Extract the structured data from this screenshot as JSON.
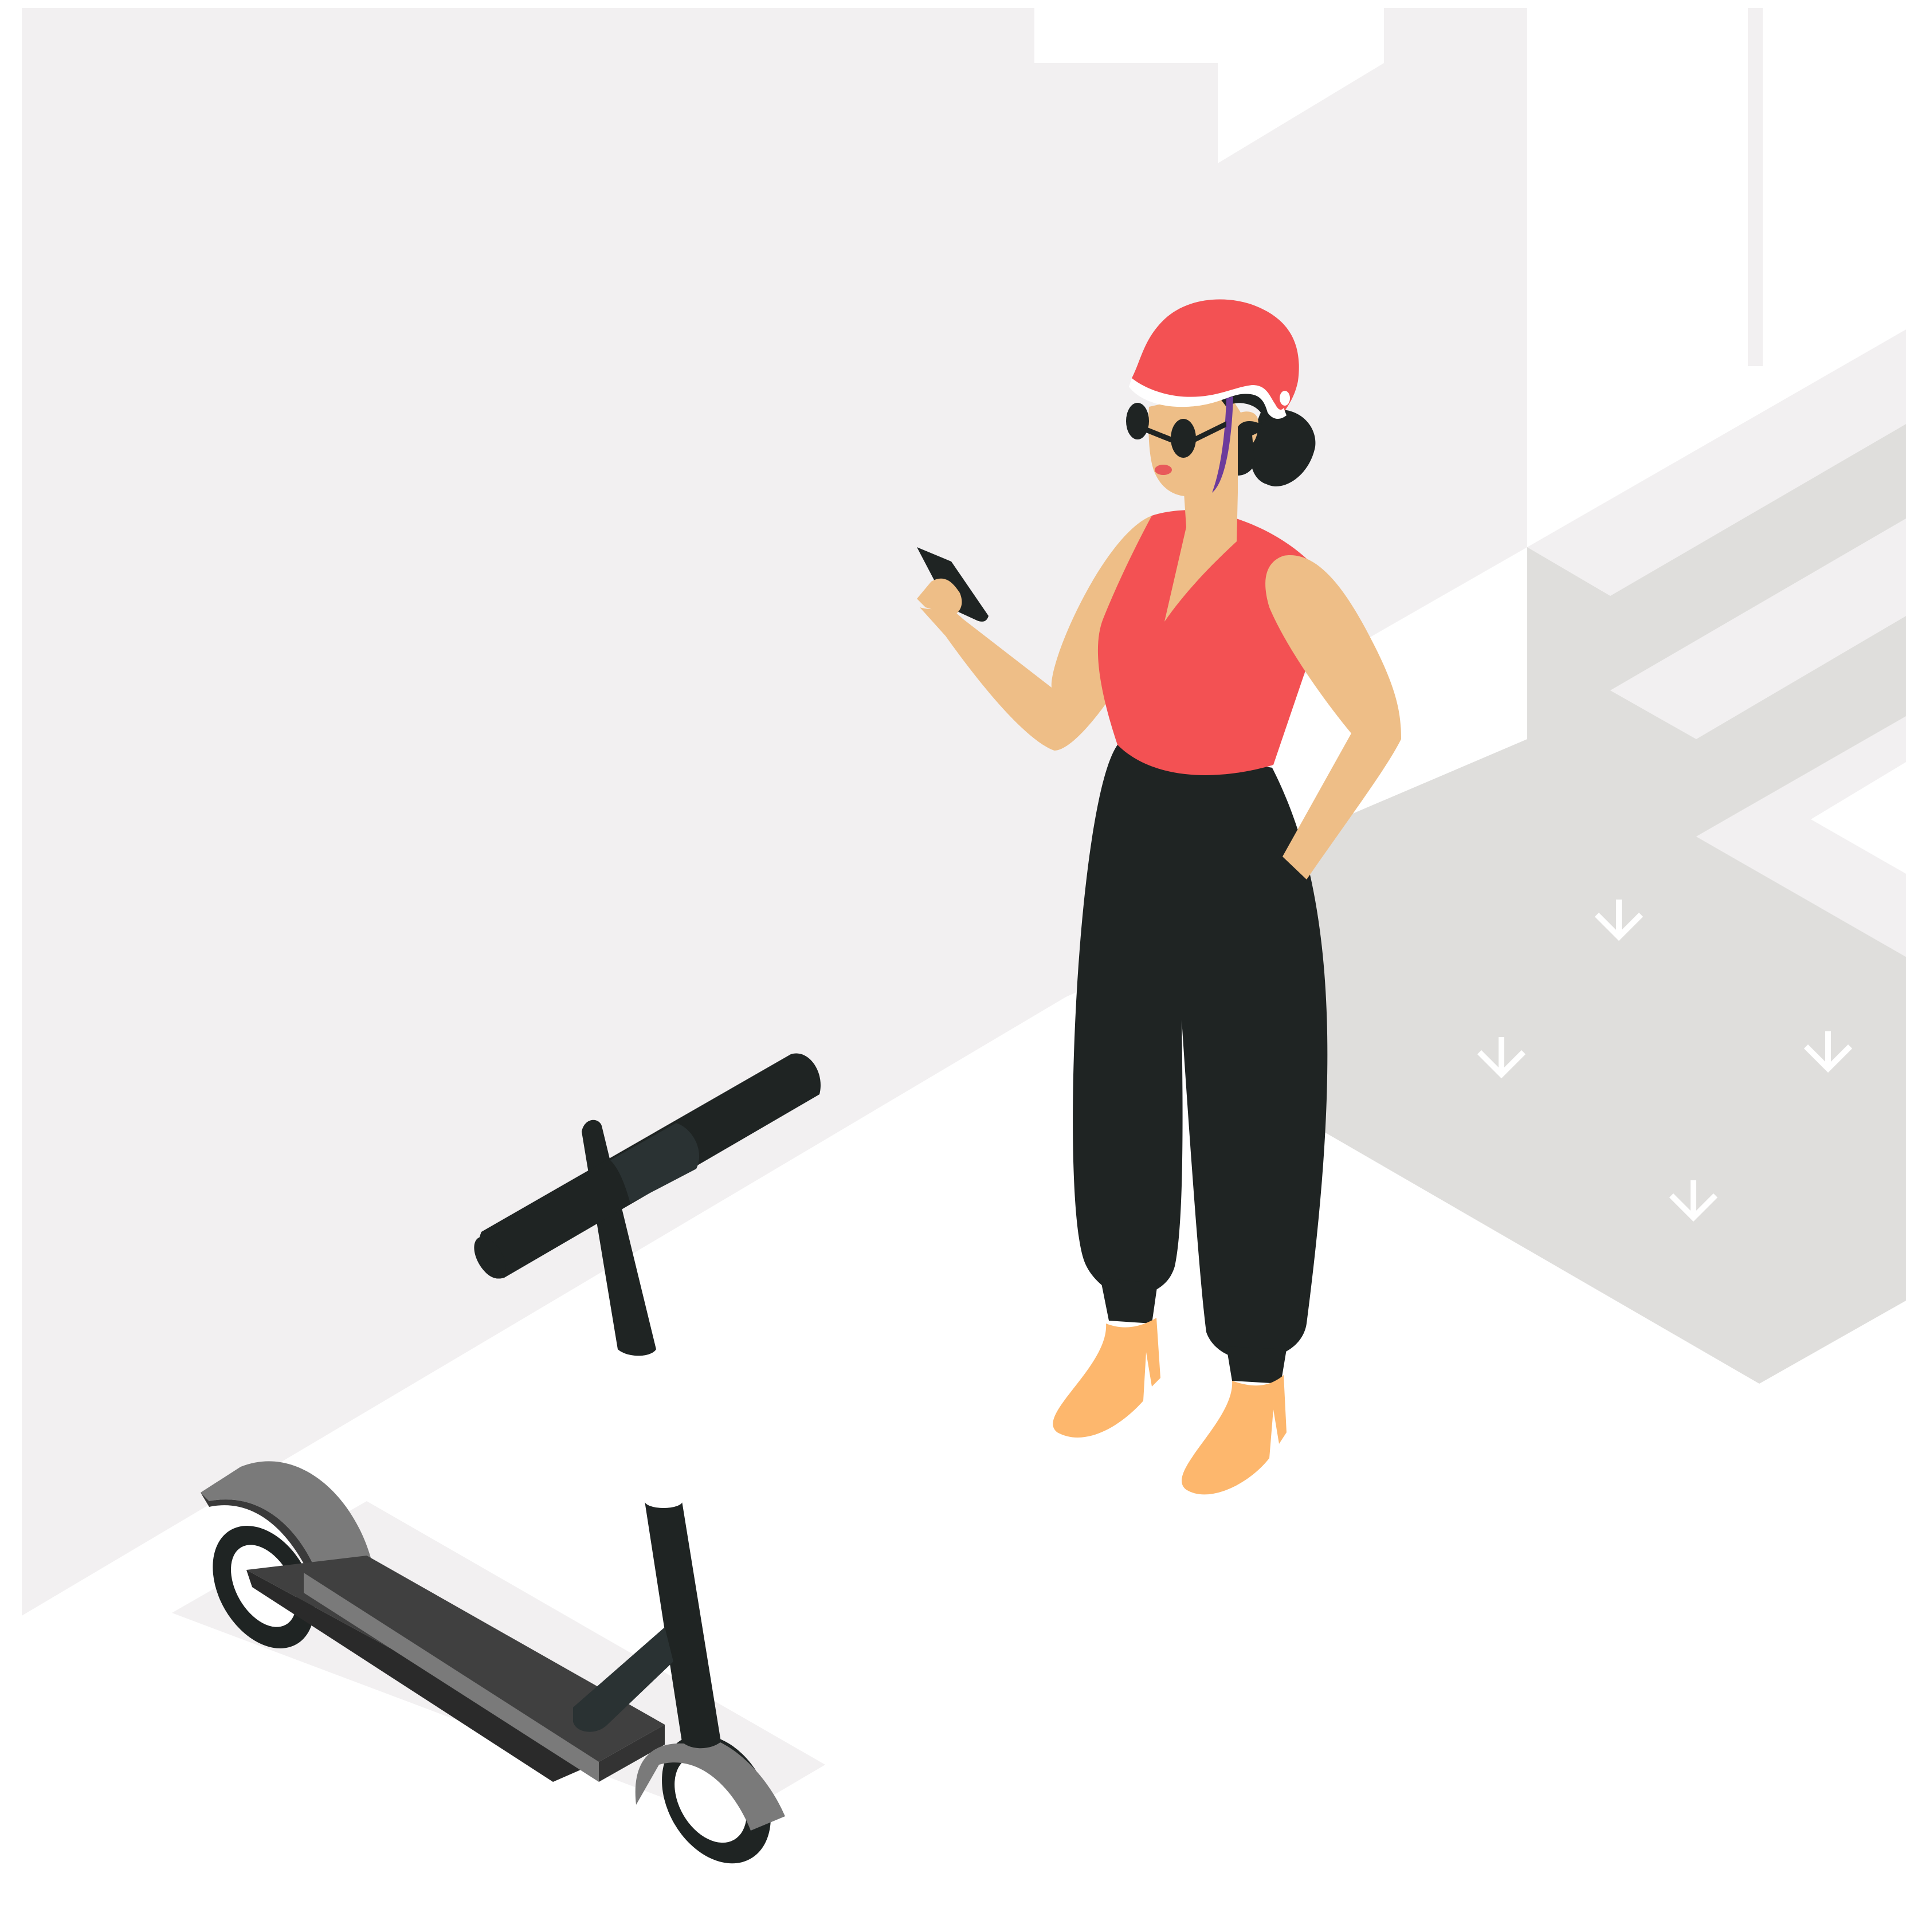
{
  "illustration": {
    "colors": {
      "background": "#ffffff",
      "wall": "#f2f0f1",
      "box_face": "#dfdedc",
      "box_top": "#f2f0f1",
      "floor_shadow": "#f2f0f1",
      "helmet": "#f35153",
      "top": "#f35153",
      "skin": "#eebe87",
      "pants": "#1f2423",
      "hair": "#1f2423",
      "shoes": "#fdb76d",
      "scooter_deck": "#404040",
      "scooter_fender": "#7a7a7a",
      "scooter_bar": "#1f2423",
      "scooter_handle_grip": "#2a3233",
      "phone": "#1f2423",
      "hair_streak": "#6c3b9b",
      "lips": "#e8595a",
      "arrow_marks": "#ffffff"
    },
    "box_arrow_icons": [
      "arrow-down-icon",
      "arrow-down-icon",
      "arrow-down-icon",
      "arrow-down-icon"
    ]
  }
}
